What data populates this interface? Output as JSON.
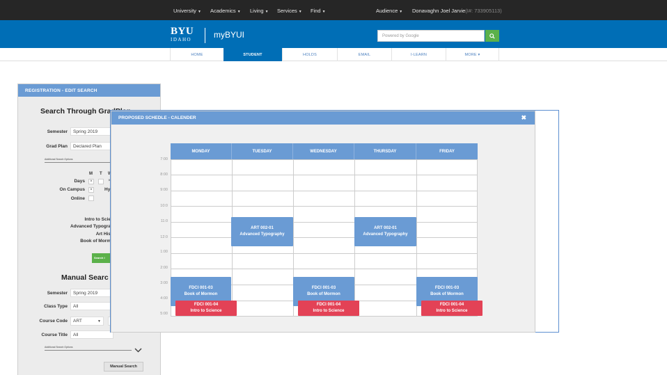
{
  "topnav": {
    "items": [
      {
        "label": "University"
      },
      {
        "label": "Academics"
      },
      {
        "label": "Living"
      },
      {
        "label": "Services"
      },
      {
        "label": "Find"
      }
    ],
    "audience": "Audience",
    "user": "Donavaghn Joel Jarvie",
    "user_id": "(I#: 733905113)"
  },
  "brand": {
    "byu": "BYU",
    "idaho": "IDAHO",
    "app": "myBYUI",
    "search_placeholder": "Powered by Google"
  },
  "mainmenu": {
    "items": [
      {
        "label": "HOME"
      },
      {
        "label": "STUDENT"
      },
      {
        "label": "HOLDS"
      },
      {
        "label": "EMAIL"
      },
      {
        "label": "I-LEARN"
      },
      {
        "label": "MORE ▾"
      }
    ],
    "active": "STUDENT"
  },
  "registration": {
    "header": "REGISTRATION - EDIT SEARCH",
    "gradplan_title": "Search Through GradPlan",
    "semester_label": "Semester",
    "semester_value": "Spring 2019",
    "gradplan_label": "Grad Plan",
    "gradplan_value": "Declared Plan",
    "additional_options": "Additional Search Options",
    "day_headers": [
      "M",
      "T",
      "W"
    ],
    "days_label": "Days",
    "oncampus_label": "On Campus",
    "oncampus_extra": "Hy",
    "online_label": "Online",
    "courses": [
      "Intro to Scie",
      "Advanced Typogra",
      "Art His",
      "Book of Morm"
    ],
    "search_btn": "Search I",
    "manual_title": "Manual Searc",
    "m_semester_label": "Semester",
    "m_semester_value": "Spring 2019",
    "classtype_label": "Class Type",
    "classtype_value": "All",
    "coursecode_label": "Course Code",
    "coursecode_value": "ART",
    "coursetitle_label": "Course Title",
    "coursetitle_value": "All",
    "manual_additional": "Additional Search Options",
    "manual_btn": "Manual Search"
  },
  "schedule": {
    "header": "PROPOSED SCHEDLE - CALENDER",
    "close": "✖",
    "days": [
      "MONDAY",
      "TUESDAY",
      "WEDNESDAY",
      "THURSDAY",
      "FRIDAY"
    ],
    "hours": [
      "7:00",
      "8:00",
      "9:00",
      "10:0",
      "11:0",
      "12:0",
      "1:00",
      "2:00",
      "3:00",
      "4:00",
      "5:00"
    ],
    "events": [
      {
        "code": "ART 002-01",
        "title": "Advanced Typography",
        "color": "blue"
      },
      {
        "code": "ART 002-01",
        "title": "Advanced Typography",
        "color": "blue"
      },
      {
        "code": "FDCI 001-03",
        "title": "Book of Mormon",
        "color": "blue"
      },
      {
        "code": "FDCI 001-03",
        "title": "Book of Mormon",
        "color": "blue"
      },
      {
        "code": "FDCI 001-03",
        "title": "Book of Mormon",
        "color": "blue"
      },
      {
        "code": "FDCI 001-04",
        "title": "Intro to Science",
        "color": "red"
      },
      {
        "code": "FDCI 001-04",
        "title": "Intro to Science",
        "color": "red"
      },
      {
        "code": "FDCI 001-04",
        "title": "Intro to Science",
        "color": "red"
      }
    ]
  },
  "colors": {
    "brand_blue": "#006eb6",
    "panel_blue": "#6a9bd4",
    "event_red": "#e34256",
    "search_green": "#5bb14a"
  }
}
